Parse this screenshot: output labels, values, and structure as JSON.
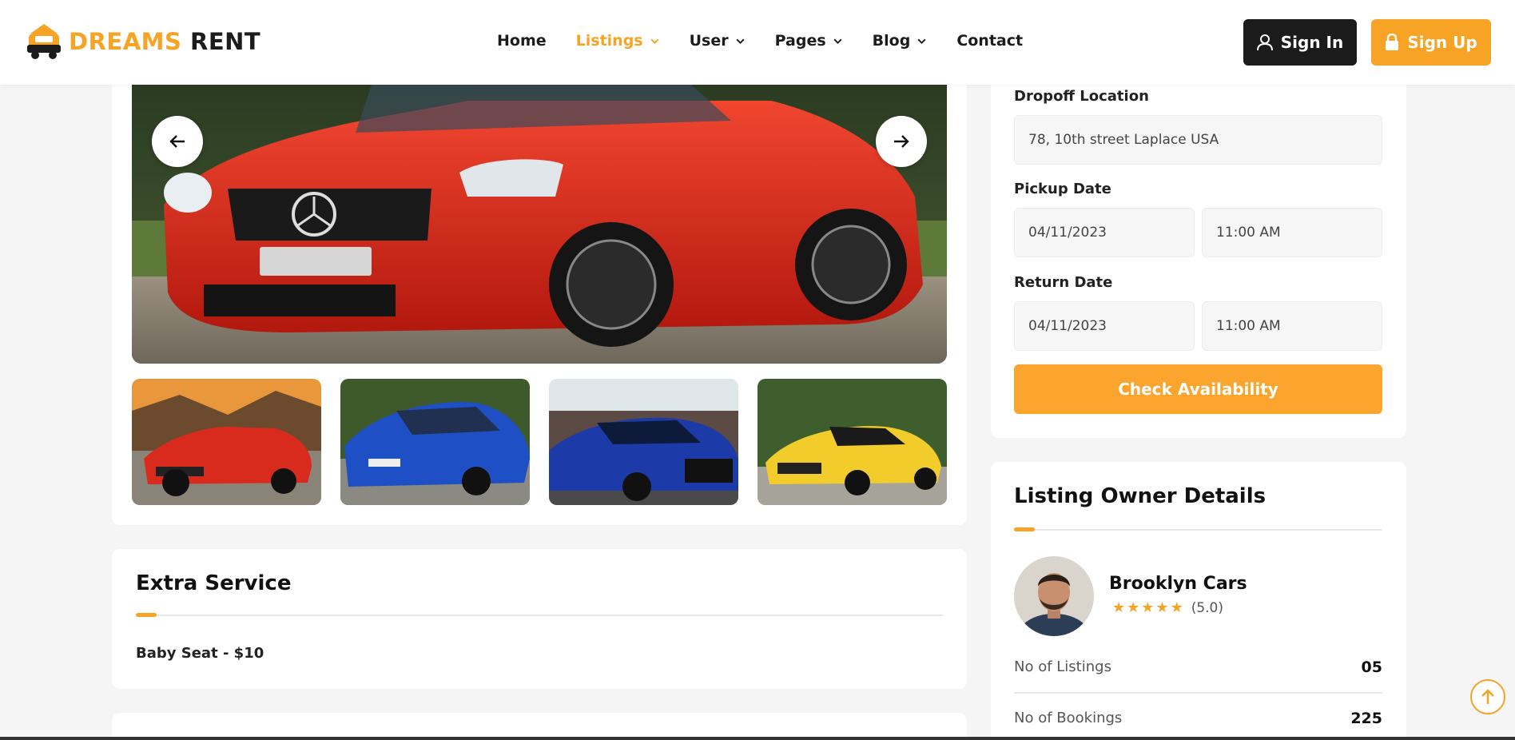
{
  "brand": {
    "part1": "DREAMS",
    "part2": "RENT",
    "accent": "#f7a325",
    "dark": "#1b1b1b"
  },
  "nav": {
    "items": [
      {
        "label": "Home",
        "dropdown": false,
        "active": false
      },
      {
        "label": "Listings",
        "dropdown": true,
        "active": true
      },
      {
        "label": "User",
        "dropdown": true,
        "active": false
      },
      {
        "label": "Pages",
        "dropdown": true,
        "active": false
      },
      {
        "label": "Blog",
        "dropdown": true,
        "active": false
      },
      {
        "label": "Contact",
        "dropdown": false,
        "active": false
      }
    ]
  },
  "auth": {
    "signin_label": "Sign In",
    "signup_label": "Sign Up"
  },
  "gallery": {
    "main_image": "red-convertible-car",
    "thumbnails": [
      "red-convertible-car",
      "blue-sedan-car",
      "blue-audi-car",
      "yellow-sports-car"
    ]
  },
  "extra_service": {
    "title": "Extra Service",
    "items": [
      "Baby Seat - $10"
    ]
  },
  "booking": {
    "dropoff_label": "Dropoff Location",
    "dropoff_value": "78, 10th street Laplace USA",
    "pickup_label": "Pickup Date",
    "pickup_date": "04/11/2023",
    "pickup_time": "11:00 AM",
    "return_label": "Return Date",
    "return_date": "04/11/2023",
    "return_time": "11:00 AM",
    "check_label": "Check Availability"
  },
  "owner": {
    "title": "Listing Owner Details",
    "name": "Brooklyn Cars",
    "rating_text": "(5.0)",
    "stars": 5,
    "stats": [
      {
        "label": "No of Listings",
        "value": "05"
      },
      {
        "label": "No of Bookings",
        "value": "225"
      }
    ]
  }
}
